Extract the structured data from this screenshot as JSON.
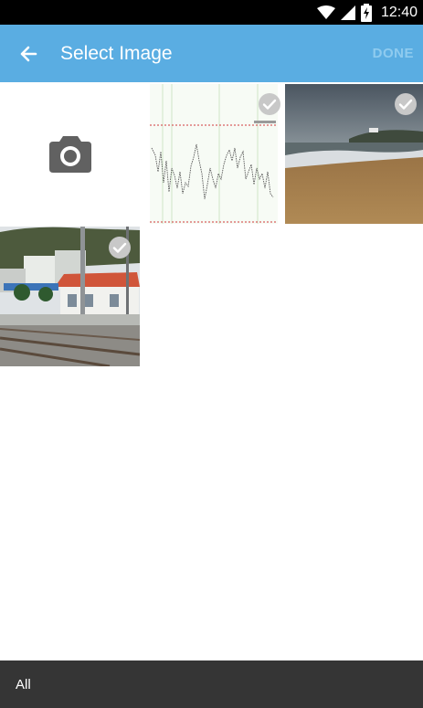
{
  "status_bar": {
    "time": "12:40",
    "icons": [
      "wifi-icon",
      "cell-signal-icon",
      "battery-charging-icon"
    ]
  },
  "app_bar": {
    "title": "Select Image",
    "done_label": "DONE",
    "back_icon": "arrow-back-icon"
  },
  "grid": {
    "items": [
      {
        "kind": "camera",
        "icon": "camera-icon",
        "selected": false
      },
      {
        "kind": "image",
        "content": "line-graph-screenshot",
        "selected": true
      },
      {
        "kind": "image",
        "content": "beach-photo",
        "selected": true
      },
      {
        "kind": "image",
        "content": "train-station-photo",
        "selected": true
      }
    ]
  },
  "bottom_bar": {
    "album_label": "All"
  },
  "colors": {
    "app_bar": "#5aade2",
    "done_disabled": "#8fcbef",
    "bottom_bar": "#353535",
    "camera_icon": "#616161",
    "check_circle": "#c8c8c8"
  }
}
